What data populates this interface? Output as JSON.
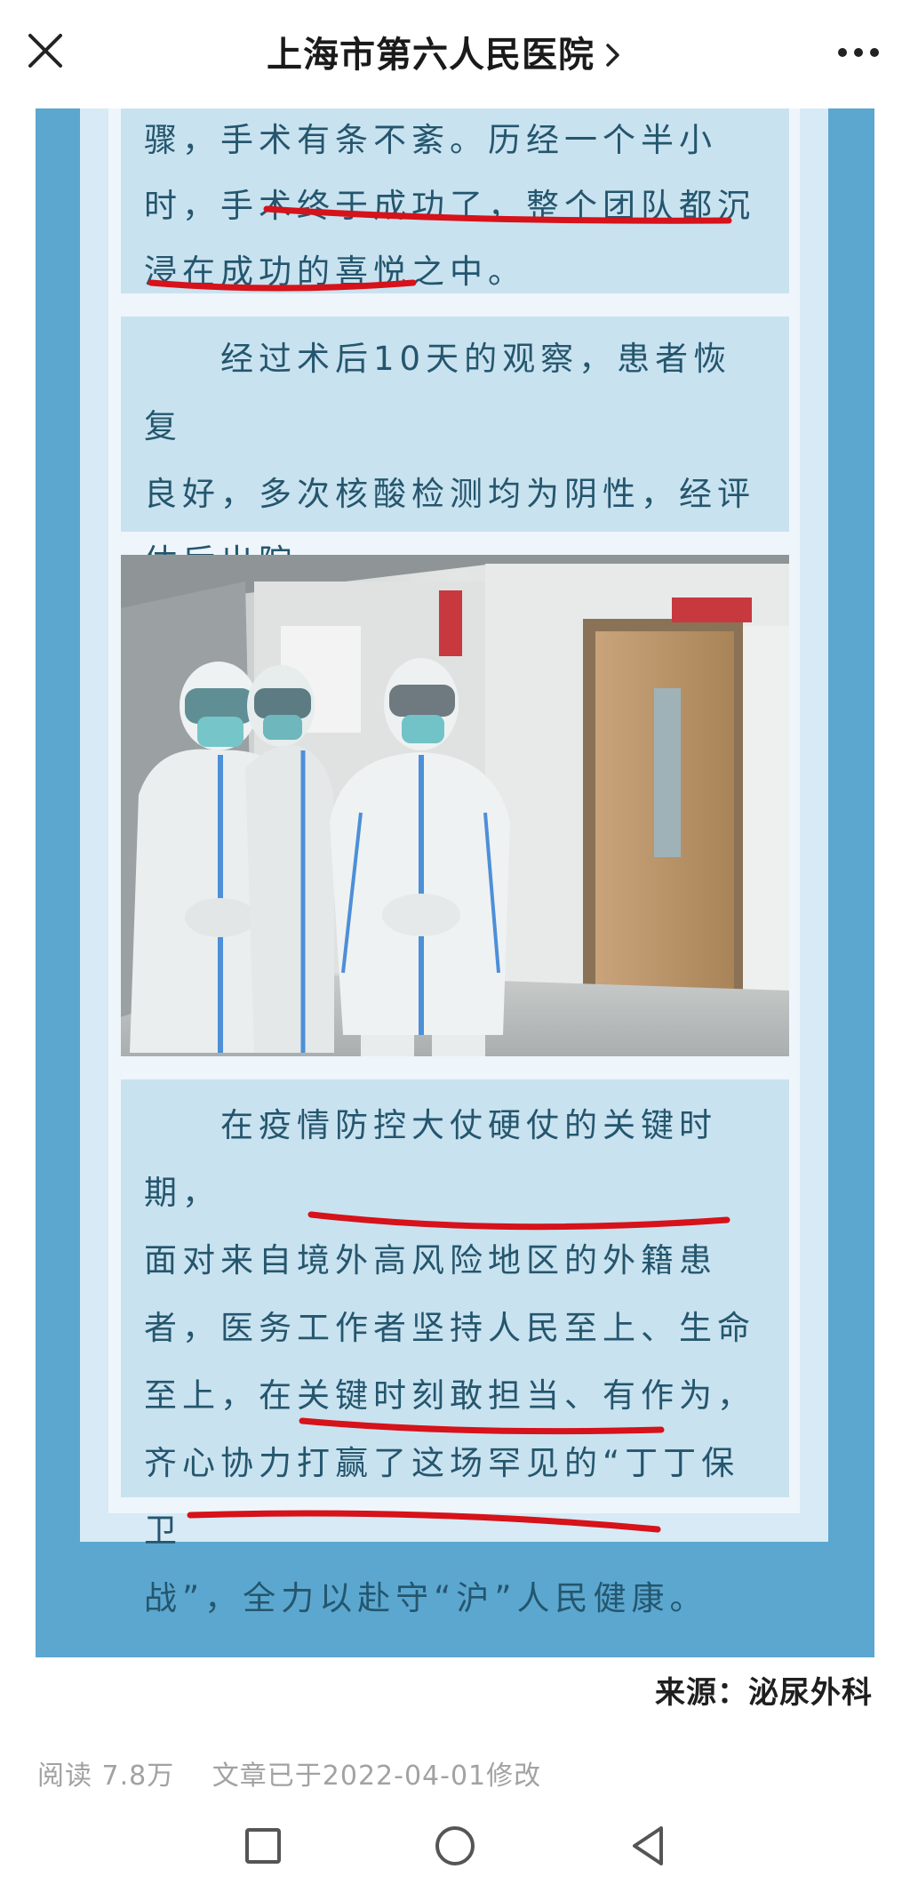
{
  "header": {
    "title": "上海市第六人民医院",
    "close_icon": "close-icon",
    "more_icon": "more-icon",
    "chevron_icon": "chevron-right-icon"
  },
  "article": {
    "paragraph1_lines": [
      "骤，手术有条不紊。历经一个半小",
      "时，手术终于成功了，整个团队都沉",
      "浸在成功的喜悦之中。"
    ],
    "paragraph2_lines": [
      "　　经过术后10天的观察，患者恢复",
      "良好，多次核酸检测均为阴性，经评",
      "估后出院。"
    ],
    "paragraph3_lines": [
      "　　在疫情防控大仗硬仗的关键时期，",
      "面对来自境外高风险地区的外籍患",
      "者，医务工作者坚持人民至上、生命",
      "至上，在关键时刻敢担当、有作为，",
      "齐心协力打赢了这场罕见的“丁丁保卫",
      "战”，全力以赴守“沪”人民健康。"
    ]
  },
  "source_label": "来源：泌尿外科",
  "meta": {
    "reads": "阅读 7.8万",
    "modified": "文章已于2022-04-01修改"
  },
  "colors": {
    "frame_blue": "#5ba7cf",
    "card_blue": "#c9e2ef",
    "text_blue": "#24566e",
    "underline_red": "#d6121a"
  },
  "navbar": {
    "back_icon": "back-triangle-icon",
    "home_icon": "home-circle-icon",
    "recents_icon": "recents-square-icon"
  }
}
